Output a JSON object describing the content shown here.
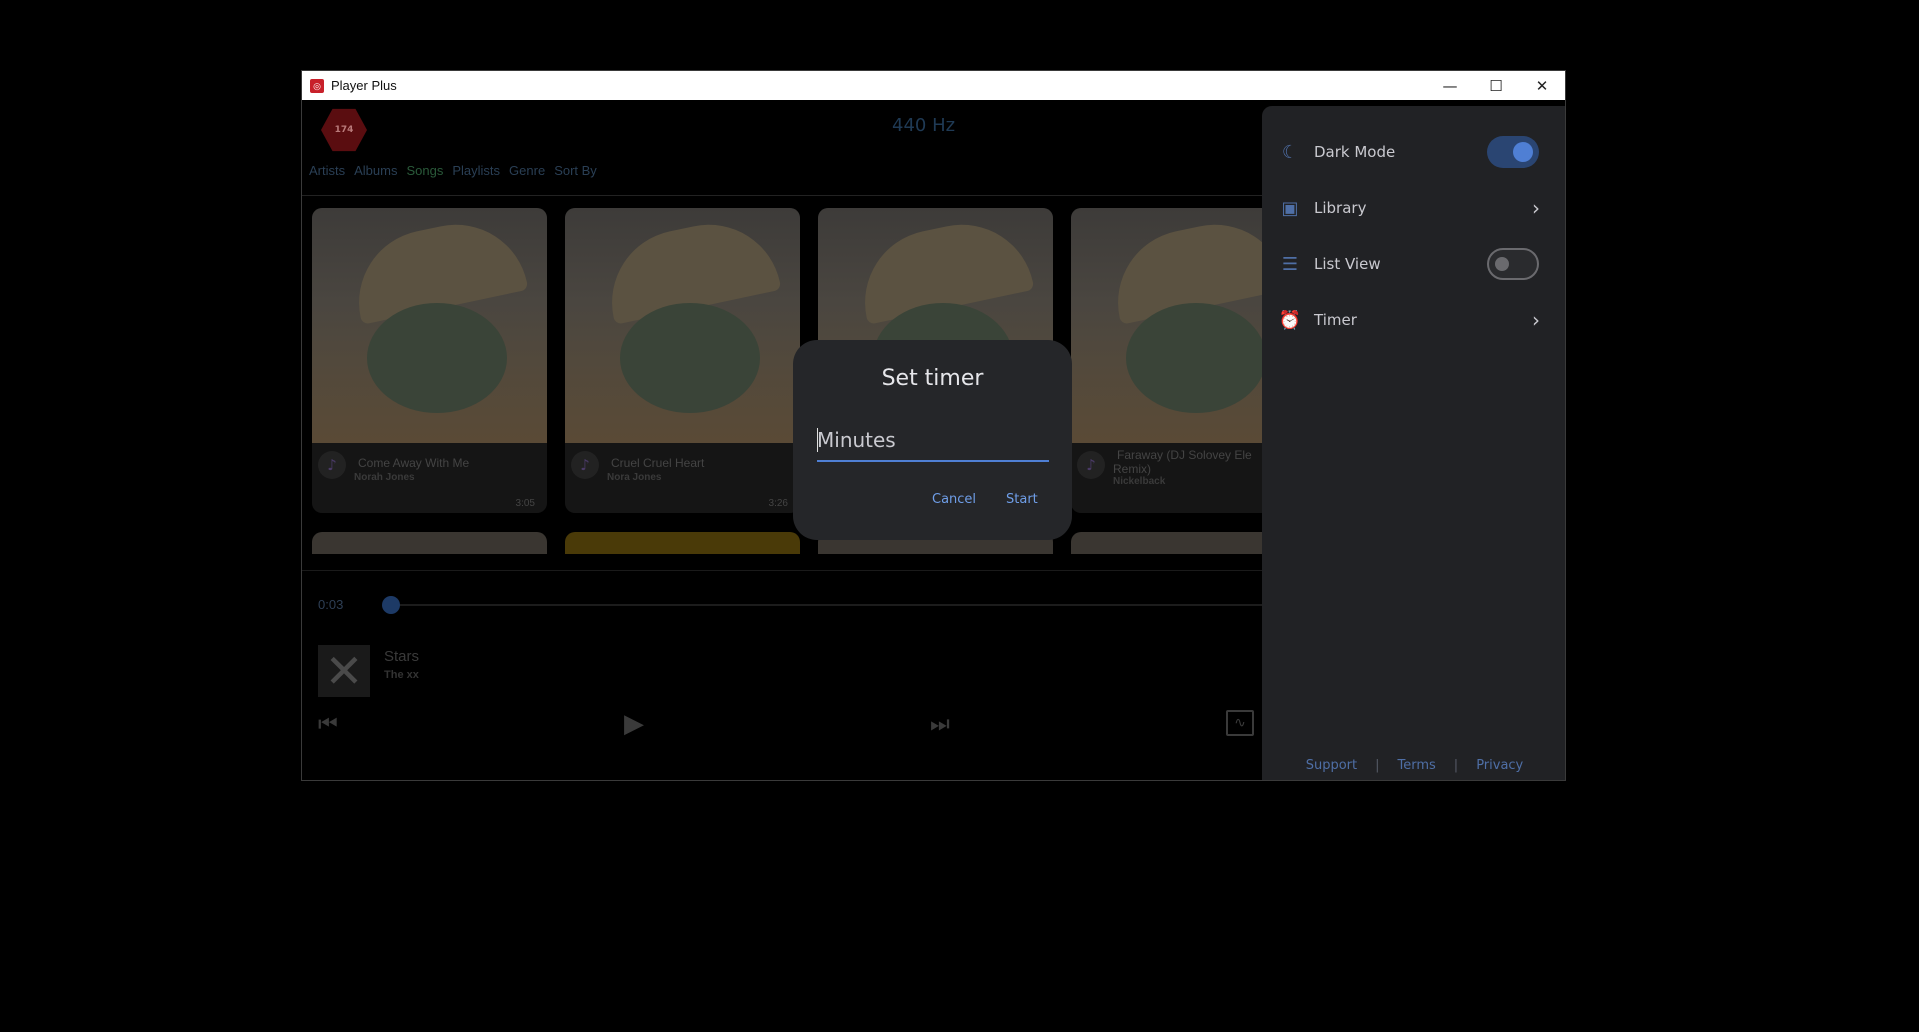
{
  "window": {
    "title": "Player Plus",
    "icon": "app-logo-icon",
    "controls": {
      "minimize": "—",
      "maximize": "☐",
      "close": "✕"
    }
  },
  "header": {
    "logo_text": "174",
    "frequency": "440 Hz"
  },
  "nav": {
    "items": [
      "Artists",
      "Albums",
      "Songs",
      "Playlists",
      "Genre",
      "Sort By"
    ],
    "active": "Songs"
  },
  "songs": [
    {
      "title": "Come Away With Me",
      "artist": "Norah Jones",
      "duration": "3:05"
    },
    {
      "title": "Cruel Cruel Heart",
      "artist": "Nora Jones",
      "duration": "3:26"
    },
    {
      "title": "",
      "artist": "",
      "duration": ""
    },
    {
      "title": "Faraway (DJ Solovey Ele",
      "title_line2": "Remix)",
      "artist": "Nickelback",
      "duration": ""
    }
  ],
  "player": {
    "elapsed": "0:03",
    "progress_fraction": 0.01,
    "now_playing": {
      "title": "Stars",
      "artist": "The xx"
    },
    "icons": [
      "skip-previous-icon",
      "play-icon",
      "skip-next-icon",
      "equalizer-icon"
    ]
  },
  "side_menu": {
    "items": [
      {
        "label": "Dark Mode",
        "icon": "moon-icon",
        "type": "toggle",
        "on": true
      },
      {
        "label": "Library",
        "icon": "library-icon",
        "type": "link"
      },
      {
        "label": "List View",
        "icon": "list-icon",
        "type": "toggle",
        "on": false
      },
      {
        "label": "Timer",
        "icon": "alarm-icon",
        "type": "link"
      }
    ],
    "footer": {
      "support": "Support",
      "terms": "Terms",
      "privacy": "Privacy",
      "separator": "|"
    }
  },
  "dialog": {
    "title": "Set timer",
    "input_placeholder": "Minutes",
    "input_value": "",
    "cancel_label": "Cancel",
    "start_label": "Start"
  },
  "colors": {
    "accent": "#4f7fd4",
    "panel_bg": "#212225",
    "dialog_bg": "#252629"
  }
}
